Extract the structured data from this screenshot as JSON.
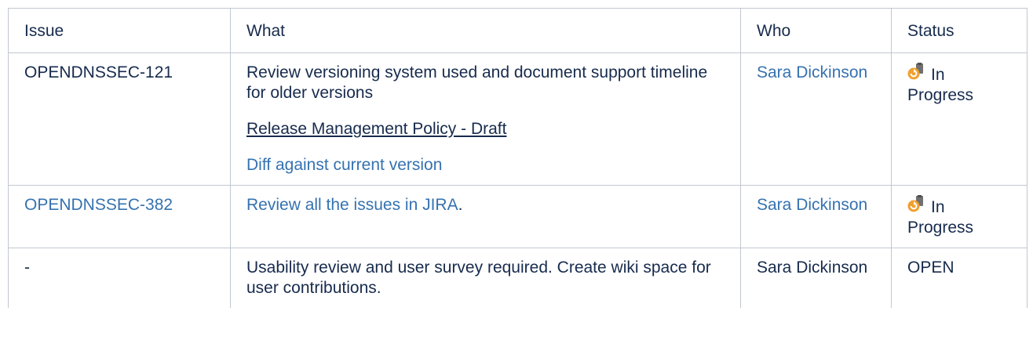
{
  "table": {
    "headers": {
      "issue": "Issue",
      "what": "What",
      "who": "Who",
      "status": "Status"
    },
    "rows": [
      {
        "issue": "OPENDNSSEC-121",
        "issue_is_link": false,
        "what_text": "Review versioning system used and document support timeline for older versions",
        "what_policy_link": "Release Management Policy - Draft",
        "what_diff_link": "Diff against current version",
        "who": "Sara Dickinson",
        "who_is_link": true,
        "status_icon": "in-progress-icon",
        "status": "In Progress"
      },
      {
        "issue": "OPENDNSSEC-382",
        "issue_is_link": true,
        "what_link": "Review all the issues in JIRA",
        "what_suffix": ".",
        "who": "Sara Dickinson",
        "who_is_link": true,
        "status_icon": "in-progress-icon",
        "status": "In Progress"
      },
      {
        "issue": "-",
        "issue_is_link": false,
        "what_text": "Usability review and user survey required. Create wiki space for user contributions.",
        "who": "Sara Dickinson",
        "who_is_link": false,
        "status": "OPEN"
      }
    ]
  },
  "colors": {
    "link": "#3572b0",
    "text": "#172b4d",
    "border": "#c1c7d0",
    "icon_orange": "#f0a030",
    "icon_gray": "#707070"
  }
}
